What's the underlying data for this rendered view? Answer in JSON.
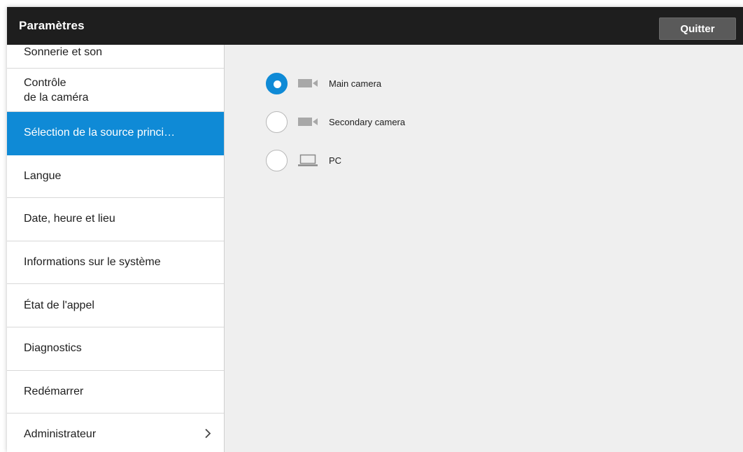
{
  "header": {
    "title": "Paramètres",
    "quit_label": "Quitter"
  },
  "sidebar": {
    "items": [
      {
        "label": "Sonnerie et son"
      },
      {
        "label": "Contrôle\nde la caméra"
      },
      {
        "label": "Sélection de la source princi…",
        "selected": true
      },
      {
        "label": "Langue"
      },
      {
        "label": "Date, heure et lieu"
      },
      {
        "label": "Informations sur le système"
      },
      {
        "label": "État de l'appel"
      },
      {
        "label": "Diagnostics"
      },
      {
        "label": "Redémarrer"
      },
      {
        "label": "Administrateur",
        "icon": "chevron-right-icon"
      }
    ]
  },
  "sources": {
    "options": [
      {
        "label": "Main camera",
        "icon": "camera-icon",
        "checked": true
      },
      {
        "label": "Secondary camera",
        "icon": "camera-icon",
        "checked": false
      },
      {
        "label": "PC",
        "icon": "laptop-icon",
        "checked": false
      }
    ]
  },
  "colors": {
    "accent": "#0f8ad6",
    "topbar": "#1e1e1e",
    "content_bg": "#efefef"
  }
}
